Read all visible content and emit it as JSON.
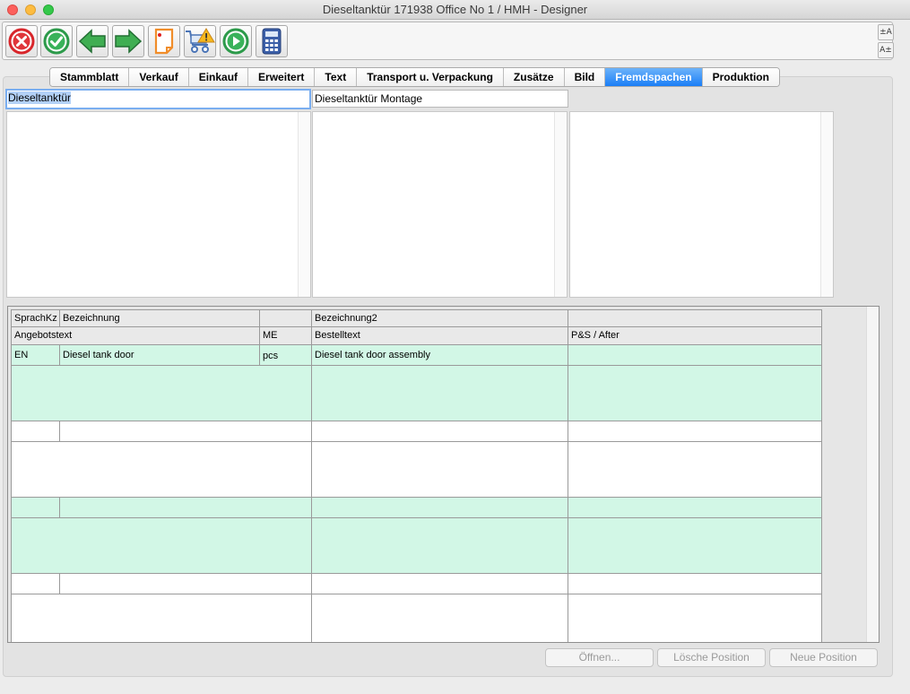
{
  "window": {
    "title": "Dieseltanktür  171938 Office No 1 /  HMH - Designer"
  },
  "toolbar": {
    "buttons": [
      {
        "name": "cancel-icon"
      },
      {
        "name": "confirm-icon"
      },
      {
        "name": "back-arrow-icon"
      },
      {
        "name": "forward-arrow-icon"
      },
      {
        "name": "note-icon"
      },
      {
        "name": "cart-warning-icon"
      },
      {
        "name": "play-icon"
      },
      {
        "name": "calculator-icon"
      }
    ],
    "font_up_label": "±A",
    "font_down_label": "A±"
  },
  "tabs": [
    {
      "label": "Stammblatt",
      "active": false
    },
    {
      "label": "Verkauf",
      "active": false
    },
    {
      "label": "Einkauf",
      "active": false
    },
    {
      "label": "Erweitert",
      "active": false
    },
    {
      "label": "Text",
      "active": false
    },
    {
      "label": "Transport u. Verpackung",
      "active": false
    },
    {
      "label": "Zusätze",
      "active": false
    },
    {
      "label": "Bild",
      "active": false
    },
    {
      "label": "Fremdspachen",
      "active": true
    },
    {
      "label": "Produktion",
      "active": false
    }
  ],
  "fields": {
    "name_value": "Dieseltanktür",
    "description_value": "Dieseltanktür Montage"
  },
  "table": {
    "header1": {
      "sprachkz": "SprachKz",
      "bezeichnung": "Bezeichnung",
      "blank": "",
      "bezeichnung2": "Bezeichnung2",
      "last": ""
    },
    "header2": {
      "angebotstext": "Angebotstext",
      "me": "ME",
      "bestelltext": "Bestelltext",
      "ps_after": "P&S / After"
    },
    "rows": [
      {
        "sprachkz": "EN",
        "bezeichnung": "Diesel tank door",
        "me": "pcs",
        "bezeichnung2": "Diesel tank door assembly",
        "last": ""
      }
    ]
  },
  "buttons": {
    "open": "Öffnen...",
    "delete_position": "Lösche Position",
    "new_position": "Neue Position"
  },
  "colors": {
    "active_tab": "#1b7ef6",
    "row_green": "#d2f7e6"
  }
}
